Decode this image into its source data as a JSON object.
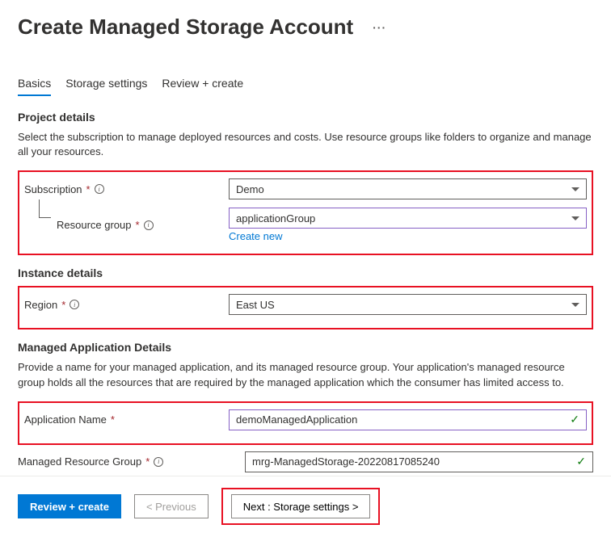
{
  "header": {
    "title": "Create Managed Storage Account",
    "ellipsis": "···"
  },
  "tabs": {
    "basics": "Basics",
    "storage": "Storage settings",
    "review": "Review + create"
  },
  "project": {
    "title": "Project details",
    "desc": "Select the subscription to manage deployed resources and costs. Use resource groups like folders to organize and manage all your resources.",
    "subscription_label": "Subscription",
    "subscription_value": "Demo",
    "rg_label": "Resource group",
    "rg_value": "applicationGroup",
    "create_new": "Create new"
  },
  "instance": {
    "title": "Instance details",
    "region_label": "Region",
    "region_value": "East US"
  },
  "managed": {
    "title": "Managed Application Details",
    "desc": "Provide a name for your managed application, and its managed resource group. Your application's managed resource group holds all the resources that are required by the managed application which the consumer has limited access to.",
    "app_name_label": "Application Name",
    "app_name_value": "demoManagedApplication",
    "mrg_label": "Managed Resource Group",
    "mrg_value": "mrg-ManagedStorage-20220817085240"
  },
  "footer": {
    "review": "Review + create",
    "previous": "< Previous",
    "next": "Next : Storage settings >"
  }
}
